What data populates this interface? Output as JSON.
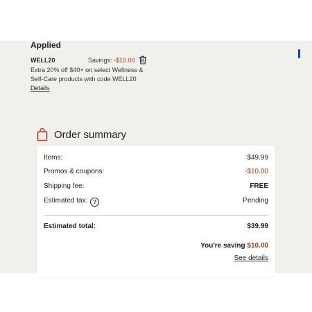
{
  "applied": {
    "title": "Applied",
    "coupon_code": "WELL20",
    "savings_label": "Savings:",
    "savings_amount": "-$10.00",
    "description": "Extra 20% off $40+ on select Wellness & Self-Care products with code WELL20",
    "details_link": "Details"
  },
  "order_summary": {
    "title": "Order summary",
    "rows": [
      {
        "label": "Items:",
        "value": "$49.99"
      },
      {
        "label": "Promos & coupons:",
        "value": "-$10.00"
      },
      {
        "label": "Shipping fee:",
        "value": "FREE"
      },
      {
        "label": "Estimated tax:",
        "value": "Pending"
      }
    ],
    "tax_help": "?",
    "total_label": "Estimated total:",
    "total_value": "$39.99",
    "saving_prefix": "You're saving",
    "saving_amount": "$10.00",
    "see_details": "See details"
  },
  "colors": {
    "discount": "#a33a1e",
    "page_bg": "#f2f0ec"
  }
}
